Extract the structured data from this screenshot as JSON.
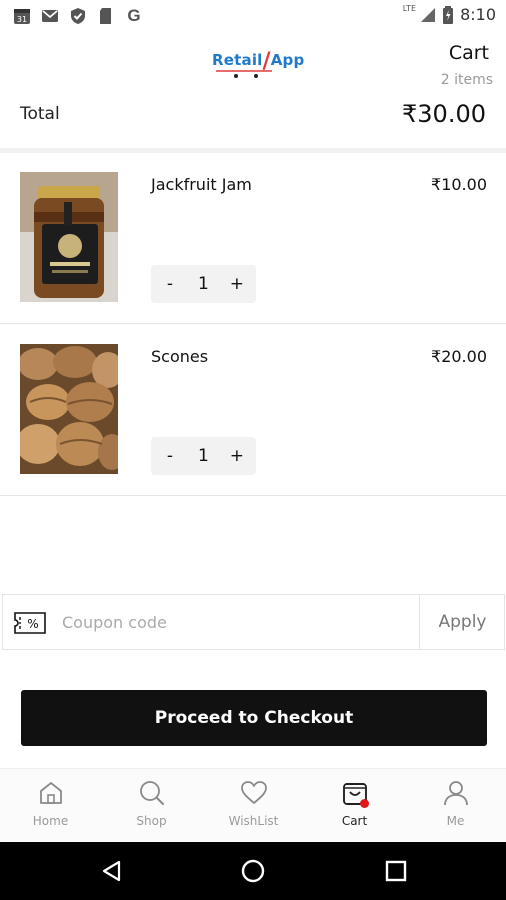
{
  "status_bar": {
    "time": "8:10",
    "signal": "LTE",
    "left_icons": [
      "calendar-31-icon",
      "gmail-icon",
      "check-shield-icon",
      "sd-card-icon",
      "google-icon"
    ],
    "calendar_day": "31",
    "google_letter": "G"
  },
  "header": {
    "logo_part1": "Retail",
    "logo_part2": "App",
    "title": "Cart",
    "item_count": "2 items"
  },
  "summary": {
    "total_label": "Total",
    "total_value": "₹30.00"
  },
  "items": [
    {
      "name": "Jackfruit Jam",
      "price": "₹10.00",
      "qty": "1",
      "image": "jackfruit-jam-jar"
    },
    {
      "name": "Scones",
      "price": "₹20.00",
      "qty": "1",
      "image": "scones-photo"
    }
  ],
  "stepper": {
    "minus": "-",
    "plus": "+"
  },
  "coupon": {
    "placeholder": "Coupon code",
    "value": "",
    "apply_label": "Apply"
  },
  "checkout": {
    "label": "Proceed to Checkout"
  },
  "bottom_nav": [
    {
      "label": "Home",
      "icon": "home-icon",
      "active": false
    },
    {
      "label": "Shop",
      "icon": "search-icon",
      "active": false
    },
    {
      "label": "WishList",
      "icon": "heart-icon",
      "active": false
    },
    {
      "label": "Cart",
      "icon": "cart-bag-icon",
      "active": true
    },
    {
      "label": "Me",
      "icon": "user-icon",
      "active": false
    }
  ],
  "colors": {
    "accent": "#111111",
    "badge": "#e21818",
    "logo_blue": "#1f7ac9",
    "logo_red": "#e23b3b"
  }
}
